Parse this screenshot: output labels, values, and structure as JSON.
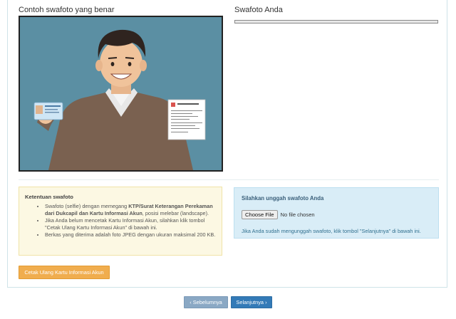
{
  "left_column": {
    "title": "Contoh swafoto yang benar"
  },
  "right_column": {
    "title": "Swafoto Anda"
  },
  "rules": {
    "title": "Ketentuan swafoto",
    "item1_prefix": "Swafoto (selfie) dengan memegang ",
    "item1_bold": "KTP/Surat Keterangan Perekaman dari Dukcapil dan Kartu Informasi Akun",
    "item1_suffix": ", posisi melebar (landscape).",
    "item2": "Jika Anda belum mencetak Kartu Informasi Akun, silahkan klik tombol \"Cetak Ulang Kartu Informasi Akun\" di bawah ini.",
    "item3": "Berkas yang diterima adalah foto JPEG dengan ukuran maksimal 200 KB."
  },
  "upload": {
    "title": "Silahkan unggah swafoto Anda",
    "choose_file_label": "Choose File",
    "no_file_text": "No file chosen",
    "note": "Jika Anda sudah mengunggah swafoto, klik tombol \"Selanjutnya\" di bawah ini."
  },
  "buttons": {
    "print_card": "Cetak Ulang Kartu Informasi Akun",
    "previous": "‹ Sebelumnya",
    "next": "Selanjutnya ›"
  },
  "colors": {
    "example_bg": "#5b8fa3",
    "rules_bg": "#fcf8e3",
    "upload_bg": "#d9edf7",
    "print_btn": "#f0ad4e",
    "prev_btn": "#8aa8c4",
    "next_btn": "#337ab7"
  }
}
